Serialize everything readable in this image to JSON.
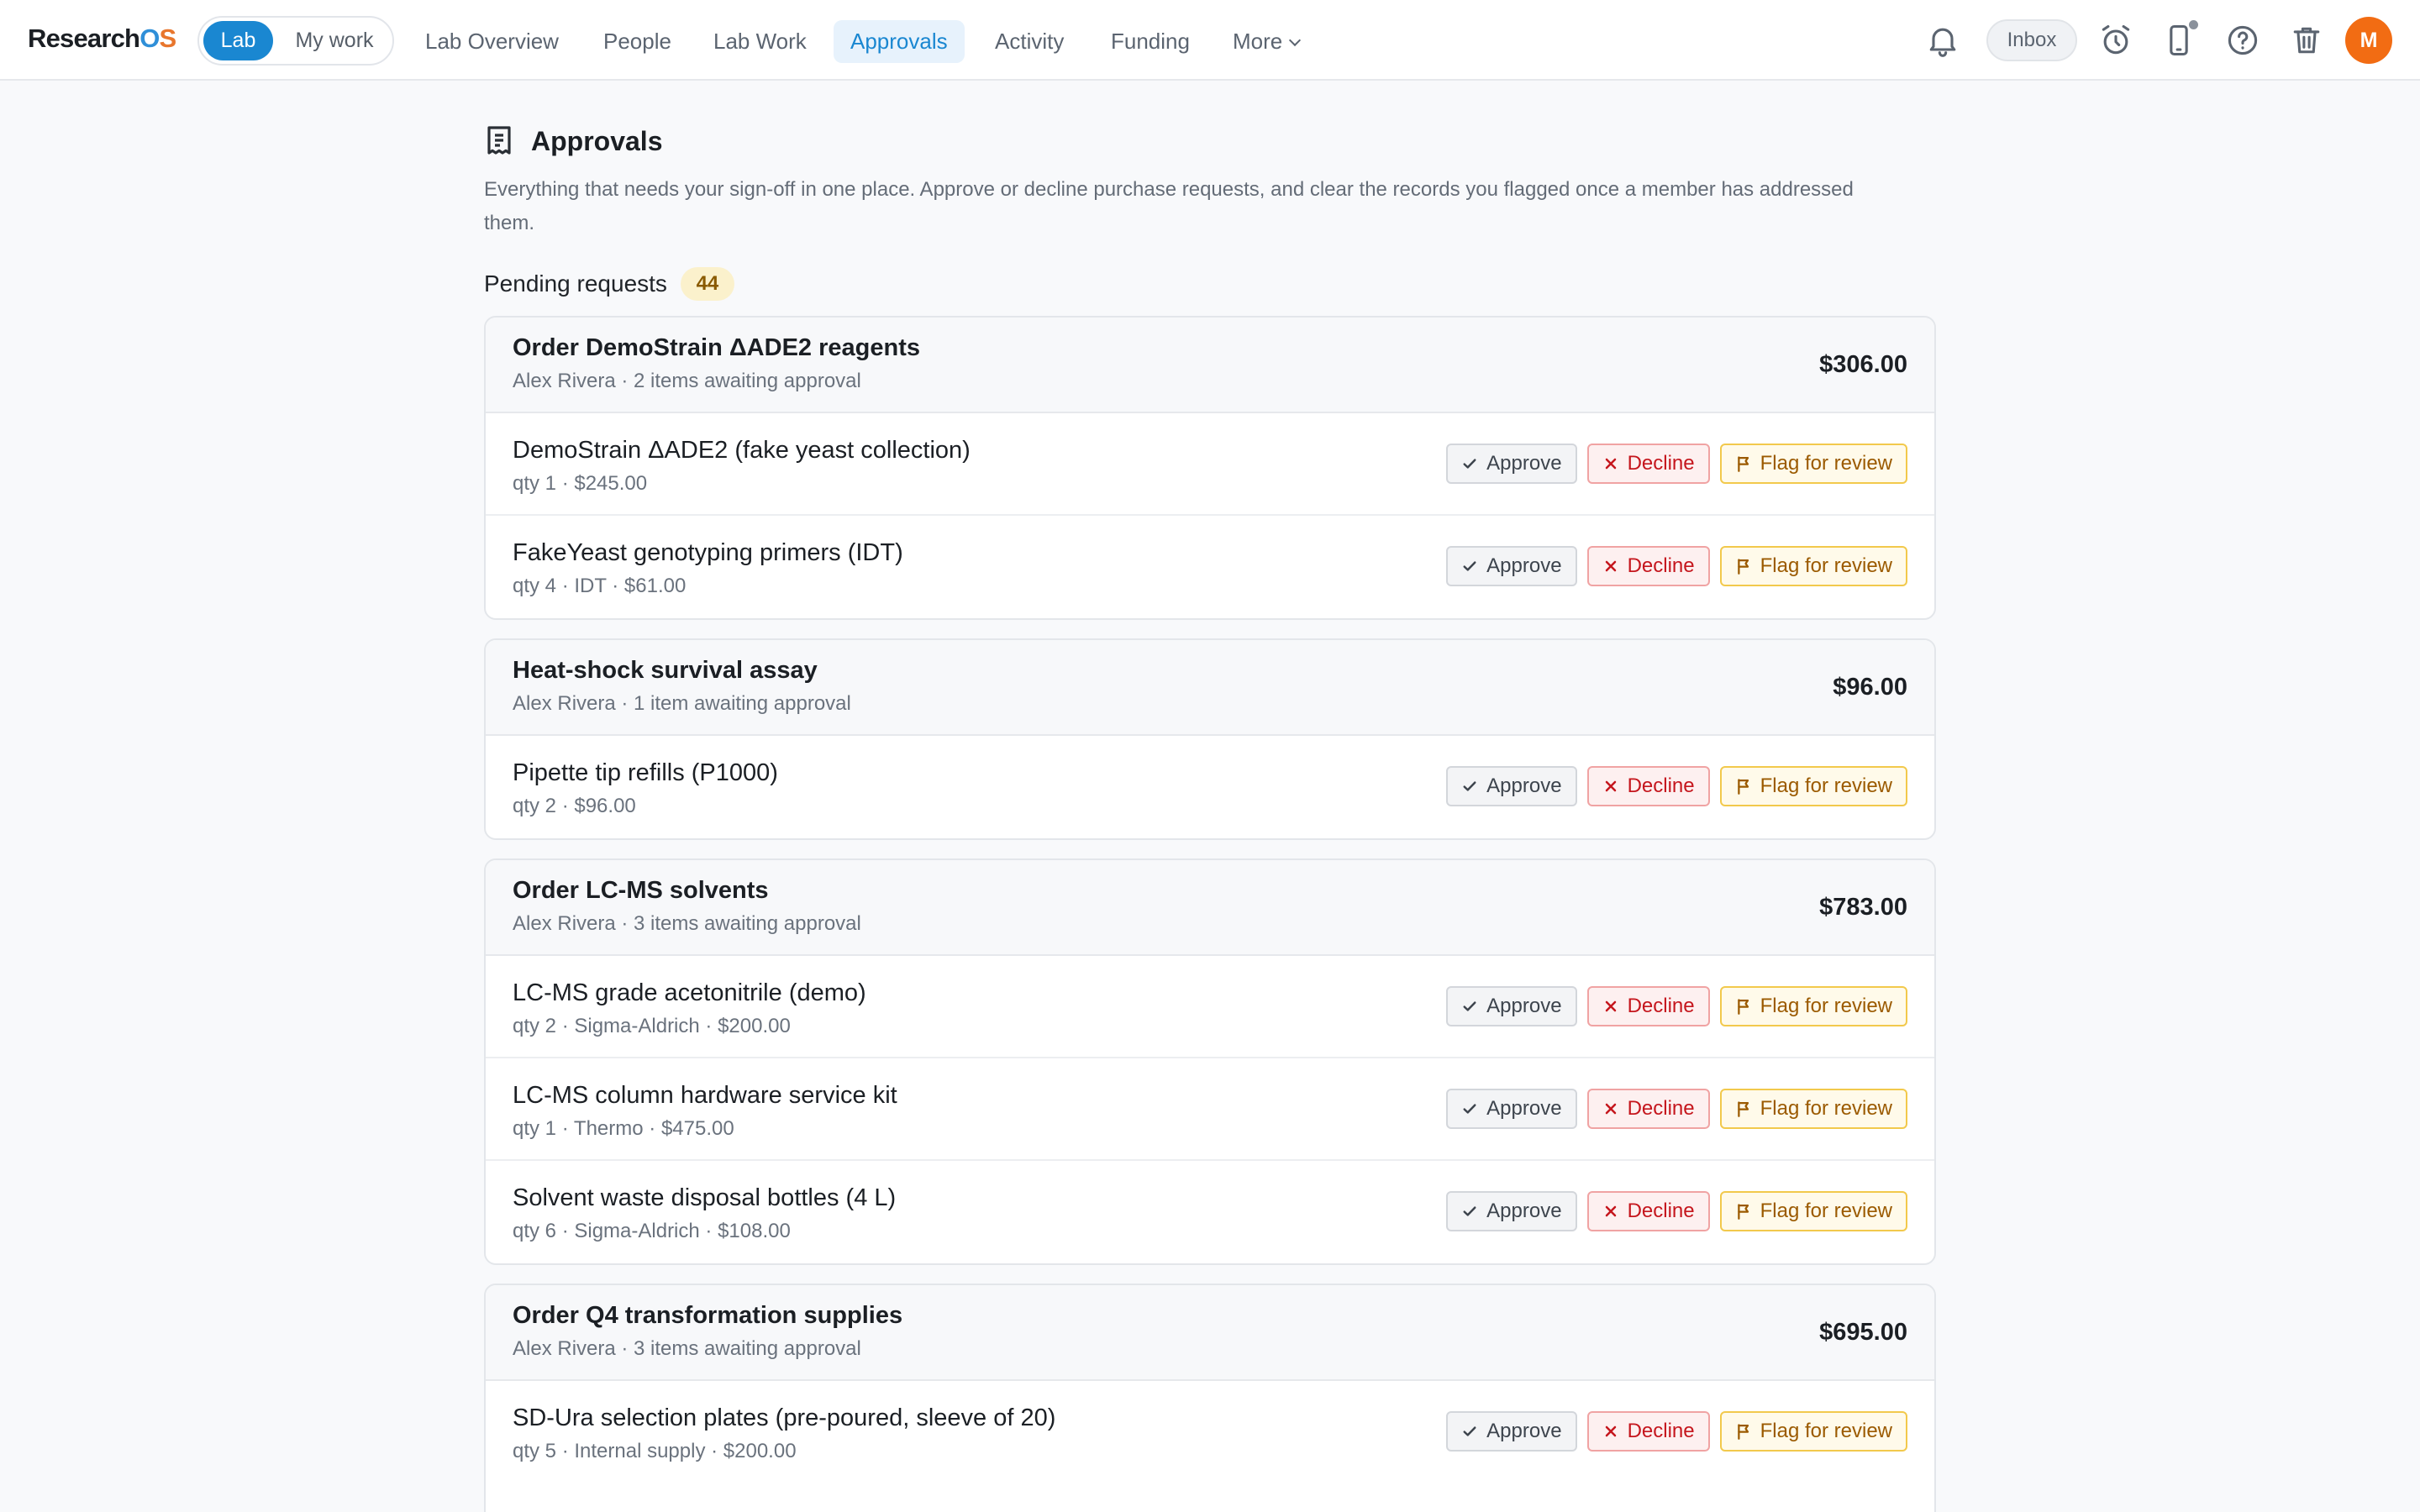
{
  "app": {
    "logo_main": "Research",
    "logo_o": "O",
    "logo_s": "S"
  },
  "scope": {
    "lab": "Lab",
    "mine": "My work"
  },
  "nav": {
    "items": [
      {
        "label": "Lab Overview"
      },
      {
        "label": "People"
      },
      {
        "label": "Lab Work"
      },
      {
        "label": "Approvals",
        "active": true
      },
      {
        "label": "Activity"
      },
      {
        "label": "Funding"
      },
      {
        "label": "More"
      }
    ]
  },
  "topbar": {
    "inbox": "Inbox",
    "avatar_initial": "M"
  },
  "icons": [
    "bell-icon",
    "alarm-clock-icon",
    "phone-icon",
    "help-icon",
    "trash-icon",
    "receipt-icon",
    "check-icon",
    "x-icon",
    "flag-icon"
  ],
  "colors": {
    "accent": "#1a87d1",
    "decline": "#c5161d",
    "flag": "#9b5a00",
    "badge_bg": "#fbf1cc",
    "avatar": "#f26c13"
  },
  "page": {
    "title": "Approvals",
    "description": "Everything that needs your sign-off in one place. Approve or decline purchase requests, and clear the records you flagged once a member has addressed them.",
    "pending_label": "Pending requests",
    "pending_count": "44"
  },
  "actions": {
    "approve": "Approve",
    "decline": "Decline",
    "flag": "Flag for review"
  },
  "groups": [
    {
      "title": "Order DemoStrain ΔADE2 reagents",
      "subtitle": "Alex Rivera · 2 items awaiting approval",
      "amount": "$306.00",
      "items": [
        {
          "name": "DemoStrain ΔADE2 (fake yeast collection)",
          "meta": "qty 1 · $245.00"
        },
        {
          "name": "FakeYeast genotyping primers (IDT)",
          "meta": "qty 4 · IDT · $61.00"
        }
      ]
    },
    {
      "title": "Heat-shock survival assay",
      "subtitle": "Alex Rivera · 1 item awaiting approval",
      "amount": "$96.00",
      "items": [
        {
          "name": "Pipette tip refills (P1000)",
          "meta": "qty 2 · $96.00"
        }
      ]
    },
    {
      "title": "Order LC-MS solvents",
      "subtitle": "Alex Rivera · 3 items awaiting approval",
      "amount": "$783.00",
      "items": [
        {
          "name": "LC-MS grade acetonitrile (demo)",
          "meta": "qty 2 · Sigma-Aldrich · $200.00"
        },
        {
          "name": "LC-MS column hardware service kit",
          "meta": "qty 1 · Thermo · $475.00"
        },
        {
          "name": "Solvent waste disposal bottles (4 L)",
          "meta": "qty 6 · Sigma-Aldrich · $108.00"
        }
      ]
    },
    {
      "title": "Order Q4 transformation supplies",
      "subtitle": "Alex Rivera · 3 items awaiting approval",
      "amount": "$695.00",
      "items": [
        {
          "name": "SD-Ura selection plates (pre-poured, sleeve of 20)",
          "meta": "qty 5 · Internal supply · $200.00"
        }
      ]
    }
  ]
}
